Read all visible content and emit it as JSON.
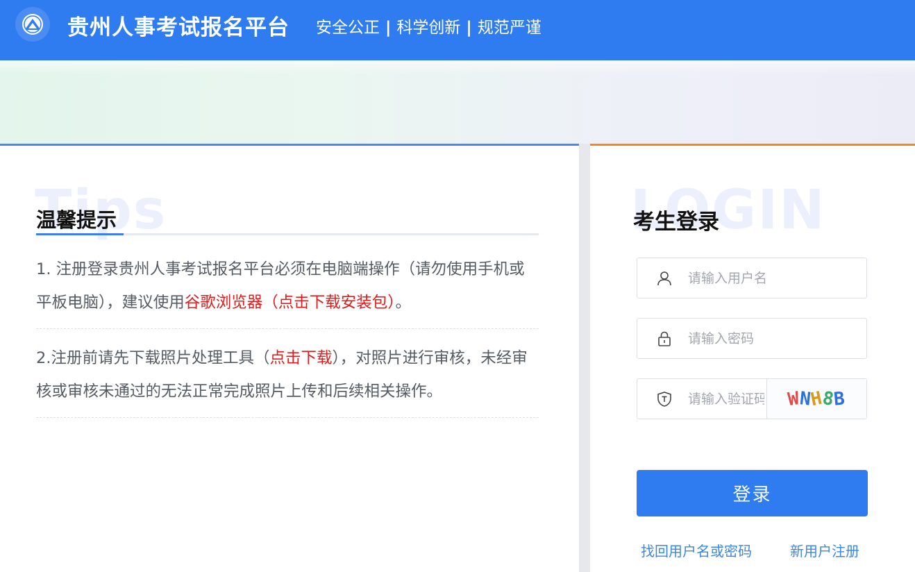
{
  "header": {
    "site_title": "贵州人事考试报名平台",
    "slogan": [
      "安全公正",
      "科学创新",
      "规范严谨"
    ],
    "slogan_separator": "|",
    "logo_icon": "mountain-emblem-icon",
    "bg_color": "#2f7bf0"
  },
  "tips": {
    "watermark": "Tips",
    "title": "温馨提示",
    "item1": {
      "before": "1. 注册登录贵州人事考试报名平台必须在电脑端操作（请勿使用手机或平板电脑），建议使用",
      "link": "谷歌浏览器（点击下载安装包）",
      "after": "。"
    },
    "item2": {
      "before": "2.注册前请先下载照片处理工具（",
      "link": "点击下载",
      "after": "），对照片进行审核，未经审核或审核未通过的无法正常完成照片上传和后续相关操作。"
    }
  },
  "login": {
    "watermark": "LOGIN",
    "title": "考生登录",
    "username_placeholder": "请输入用户名",
    "password_placeholder": "请输入密码",
    "captcha_placeholder": "请输入验证码",
    "captcha_chars": [
      "W",
      "N",
      "H",
      "8",
      "B"
    ],
    "submit_label": "登录",
    "forgot_label": "找回用户名或密码",
    "register_label": "新用户注册",
    "accent_color": "#f08a1d",
    "button_color": "#2f7bf0"
  }
}
